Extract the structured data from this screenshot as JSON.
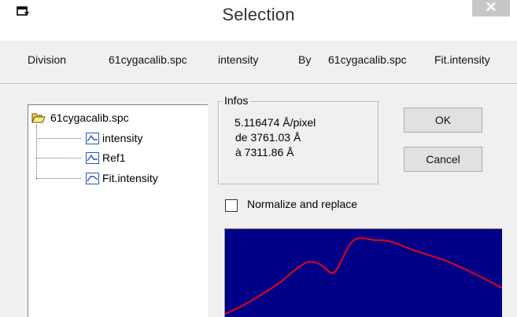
{
  "window": {
    "title": "Selection",
    "close_label": "✕"
  },
  "operation": {
    "label": "Division",
    "operand1": "61cygacalib.spc",
    "operand1_field": "intensity",
    "by_label": "By",
    "operand2": "61cygacalib.spc",
    "operand2_field": "Fit.intensity"
  },
  "tree": {
    "root": "61cygacalib.spc",
    "items": [
      {
        "label": "intensity",
        "icon": "wave-icon"
      },
      {
        "label": "Ref1",
        "icon": "wave-icon"
      },
      {
        "label": "Fit.intensity",
        "icon": "wave-icon"
      }
    ]
  },
  "infos": {
    "legend": "Infos",
    "line1": "5.116474 Å/pixel",
    "line2": "de 3761.03 Å",
    "line3": "à  7311.86 Å"
  },
  "buttons": {
    "ok": "OK",
    "cancel": "Cancel"
  },
  "normalize": {
    "label": "Normalize and replace",
    "checked": false
  },
  "colors": {
    "preview_bg": "#000086",
    "curve": "#e8001a"
  }
}
